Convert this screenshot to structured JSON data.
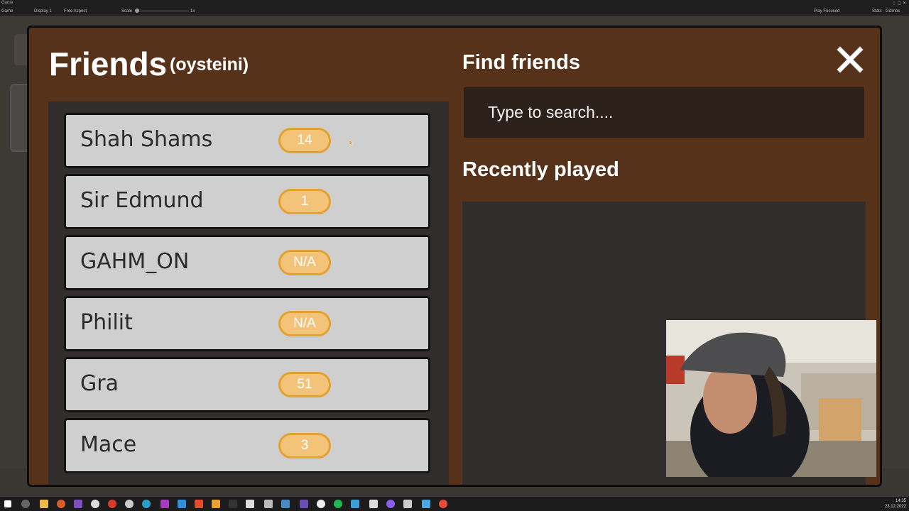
{
  "editor": {
    "tab_label": "Game",
    "view_label": "Game",
    "display": "Display 1",
    "aspect": "Free Aspect",
    "scale_label": "Scale",
    "scale_value": "1x",
    "play_mode": "Play Focused",
    "stats_label": "Stats",
    "gizmos_label": "Gizmos"
  },
  "panel": {
    "title": "Friends",
    "username": "(oysteini)",
    "find_title": "Find friends",
    "search_placeholder": "Type to search....",
    "recent_title": "Recently played",
    "close_icon": "close-x-icon"
  },
  "friends": [
    {
      "name": "Shah Shams",
      "badge": "14"
    },
    {
      "name": "Sir Edmund",
      "badge": "1"
    },
    {
      "name": "GAHM_ON",
      "badge": "N/A"
    },
    {
      "name": "Philit",
      "badge": "N/A"
    },
    {
      "name": "Gra",
      "badge": "51"
    },
    {
      "name": "Mace",
      "badge": "3"
    }
  ],
  "colors": {
    "panel_bg": "#57321a",
    "list_bg": "#302d2c",
    "row_bg": "#cfcfcf",
    "badge_fill": "#f4c37a",
    "badge_border": "#e3a230",
    "search_bg": "#2b201a"
  },
  "taskbar": {
    "time": "14:35",
    "date": "23.12.2022"
  }
}
